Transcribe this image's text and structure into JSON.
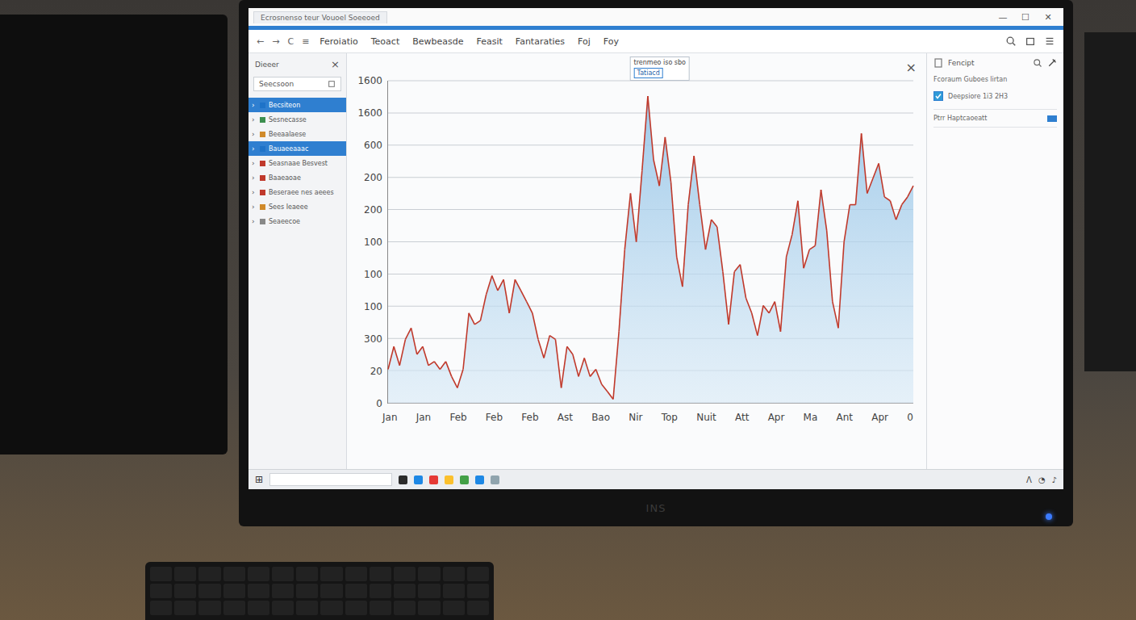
{
  "window": {
    "tab_title": "Ecrosnenso teur Vouoel Soeeoed",
    "controls": [
      "—",
      "☐",
      "✕"
    ]
  },
  "toolbar": {
    "nav": [
      "←",
      "→",
      "C",
      "≡"
    ],
    "menu": [
      {
        "label": "Feroiatio",
        "selected": false
      },
      {
        "label": "Teoact",
        "selected": false
      },
      {
        "label": "Bewbeasde",
        "selected": false
      },
      {
        "label": "Feasit",
        "selected": false
      },
      {
        "label": "Fantaraties",
        "selected": false
      },
      {
        "label": "Foj",
        "selected": false
      },
      {
        "label": "Foy",
        "selected": false
      }
    ]
  },
  "sidebar": {
    "title": "Dieeer",
    "close": "×",
    "search": "Seecsoon",
    "expander": "›",
    "items": [
      {
        "label": "Becsiteon",
        "selected": true,
        "color": "#1e73c8"
      },
      {
        "label": "Sesnecasse",
        "selected": false,
        "color": "#3d8f4f"
      },
      {
        "label": "Beeaalaese",
        "selected": false,
        "color": "#d08a2a"
      },
      {
        "label": "Bauaeeaaac",
        "selected": true,
        "color": "#1e73c8"
      },
      {
        "label": "Seasnaae Besvest",
        "selected": false,
        "color": "#c0392b"
      },
      {
        "label": "Baaeaoae",
        "selected": false,
        "color": "#c0392b"
      },
      {
        "label": "Beseraee nes aeees",
        "selected": false,
        "color": "#c0392b"
      },
      {
        "label": "Sees Ieaeee",
        "selected": false,
        "color": "#d08a2a"
      },
      {
        "label": "Seaeecoe",
        "selected": false,
        "color": "#888888"
      }
    ]
  },
  "chart": {
    "close": "×",
    "y_ticks": [
      "1600",
      "1600",
      "600",
      "200",
      "200",
      "100",
      "100",
      "100",
      "300",
      "20",
      "0"
    ],
    "x_labels": [
      "Jan",
      "Jan",
      "Feb",
      "Feb",
      "Feb",
      "Ast",
      "Bao",
      "Nir",
      "Top",
      "Nuit",
      "Att",
      "Apr",
      "Ma",
      "Ant",
      "Apr",
      "0"
    ],
    "tooltip": {
      "title": "trenmeo iso sbo",
      "value": "Tatiacd"
    },
    "series": [
      {
        "name": "series-1",
        "values": [
          112,
          188,
          125,
          212,
          250,
          162,
          188,
          125,
          138,
          112,
          138,
          88,
          50,
          112,
          300,
          262,
          275,
          362,
          425,
          375,
          412,
          300,
          412,
          375,
          338,
          300,
          212,
          150,
          225,
          212,
          50,
          188,
          162,
          88,
          150,
          88,
          112,
          62,
          38,
          12,
          238,
          512,
          700,
          538,
          775,
          1025,
          812,
          725,
          888,
          738,
          488,
          388,
          662,
          825,
          662,
          512,
          612,
          588,
          438,
          262,
          438,
          462,
          350,
          300,
          225,
          325,
          300,
          338,
          238,
          488,
          562,
          675,
          450,
          512,
          525,
          712,
          575,
          338,
          250,
          538,
          662,
          662,
          900,
          700,
          750,
          800,
          688,
          675,
          612,
          662,
          688,
          725
        ]
      }
    ]
  },
  "right_panel": {
    "title": "Fencipt",
    "subtitle": "Fcoraum Guboes lirtan",
    "checkbox": {
      "label": "Deepsiore 1i3 2H3",
      "checked": true
    },
    "toggle": {
      "label": "Ptrr Haptcaoeatt",
      "on": true
    }
  },
  "taskbar": {
    "start": "⊞",
    "apps": [
      {
        "color": "#2b2b2b"
      },
      {
        "color": "#1e88e5"
      },
      {
        "color": "#e53935"
      },
      {
        "color": "#fbc02d"
      },
      {
        "color": "#43a047"
      },
      {
        "color": "#1e88e5"
      },
      {
        "color": "#90a4ae"
      }
    ],
    "tray": [
      "ᐱ",
      "◔",
      "♪"
    ]
  },
  "monitor": {
    "brand": "INS",
    "power_on": true
  }
}
